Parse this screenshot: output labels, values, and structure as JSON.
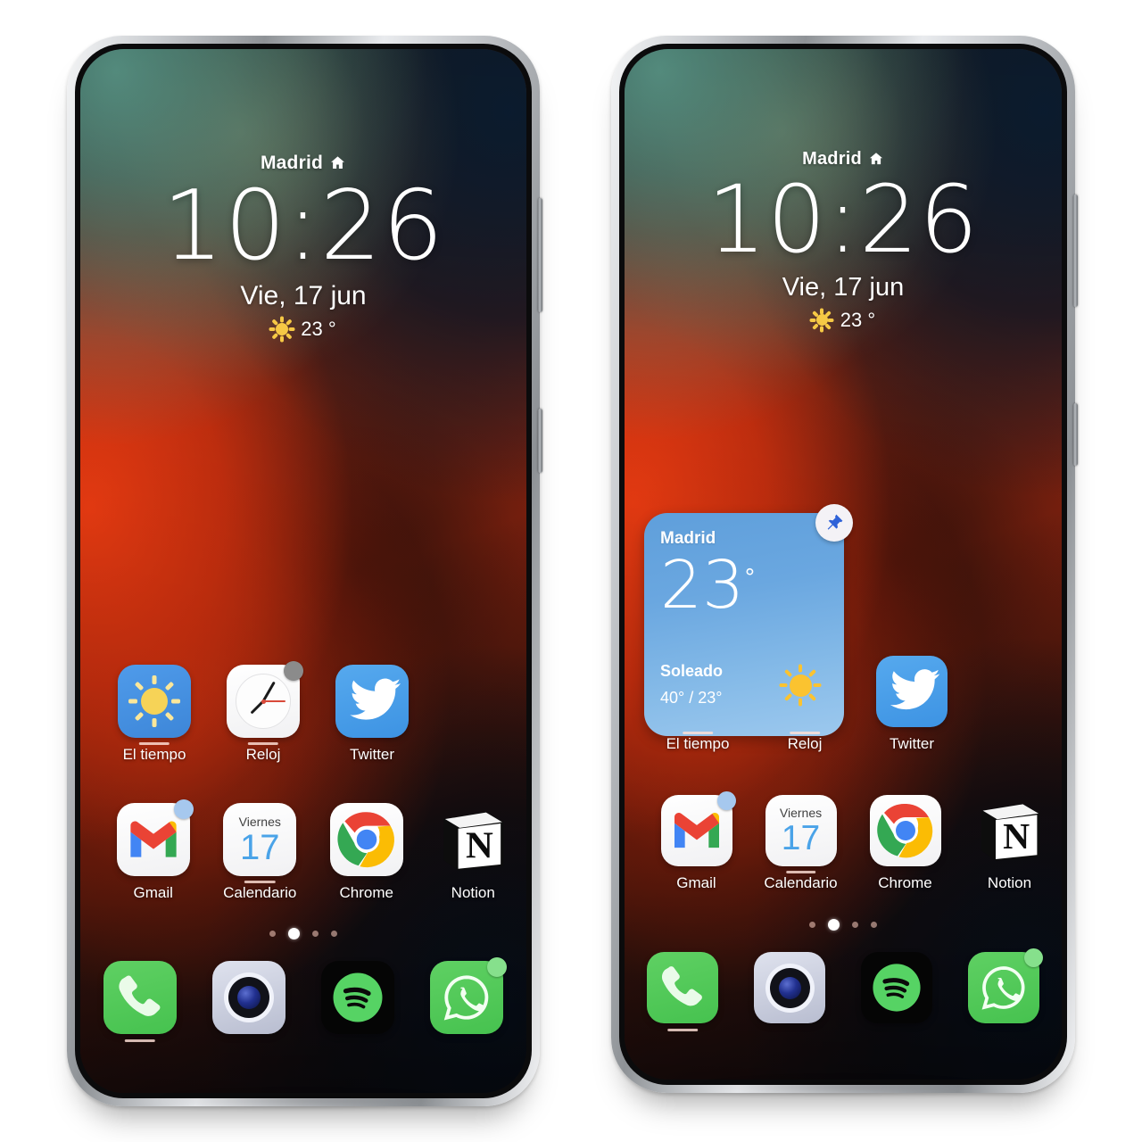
{
  "meta": {
    "scene": "two-android-phones-home-screen",
    "accent_blue": "#4a90e2",
    "wallpaper_colors": [
      "#2e5e58",
      "#b0aa78",
      "#0a1c30",
      "#ec3c12",
      "#090a10"
    ]
  },
  "phones": [
    {
      "id": "left",
      "lock": {
        "location": "Madrid",
        "home_icon": "home-icon",
        "time": "10:26",
        "date": "Vie, 17 jun",
        "weather_icon": "sun-icon",
        "temperature": "23 °"
      },
      "has_widget": false,
      "rows": [
        {
          "apps": [
            {
              "name": "El tiempo",
              "icon": "weather-icon",
              "badge": null,
              "open_bar": true
            },
            {
              "name": "Reloj",
              "icon": "clock-icon",
              "badge": "gray",
              "open_bar": true
            },
            {
              "name": "Twitter",
              "icon": "twitter-icon",
              "badge": null,
              "open_bar": false
            }
          ]
        },
        {
          "apps": [
            {
              "name": "Gmail",
              "icon": "gmail-icon",
              "badge": "blue",
              "open_bar": false
            },
            {
              "name": "Calendario",
              "icon": "calendar-icon",
              "badge": null,
              "open_bar": true
            },
            {
              "name": "Chrome",
              "icon": "chrome-icon",
              "badge": null,
              "open_bar": false
            },
            {
              "name": "Notion",
              "icon": "notion-icon",
              "badge": null,
              "open_bar": false
            }
          ]
        }
      ],
      "calendar": {
        "weekday": "Viernes",
        "day": "17"
      },
      "pager": {
        "count": 4,
        "active_index": 1
      },
      "dock": [
        {
          "name": "Telefono",
          "icon": "phone-icon",
          "badge": null,
          "open_bar": true
        },
        {
          "name": "Camara",
          "icon": "camera-icon",
          "badge": null,
          "open_bar": false
        },
        {
          "name": "Spotify",
          "icon": "spotify-icon",
          "badge": null,
          "open_bar": false
        },
        {
          "name": "WhatsApp",
          "icon": "whatsapp-icon",
          "badge": "green",
          "open_bar": false
        }
      ]
    },
    {
      "id": "right",
      "lock": {
        "location": "Madrid",
        "home_icon": "home-icon",
        "time": "10:26",
        "date": "Vie, 17 jun",
        "weather_icon": "sun-icon",
        "temperature": "23 °"
      },
      "has_widget": true,
      "widget": {
        "type": "weather-widget",
        "city": "Madrid",
        "temperature": "23",
        "degree_symbol": "°",
        "condition": "Soleado",
        "range": "40° / 23°",
        "condition_icon": "sun-icon",
        "pin_icon": "pin-icon"
      },
      "rows": [
        {
          "apps": [
            {
              "name": "El tiempo",
              "icon": "weather-icon",
              "badge": null,
              "open_bar": true
            },
            {
              "name": "Reloj",
              "icon": "clock-icon",
              "badge": "gray",
              "open_bar": true
            },
            {
              "name": "Twitter",
              "icon": "twitter-icon",
              "badge": null,
              "open_bar": false
            }
          ]
        },
        {
          "apps": [
            {
              "name": "Gmail",
              "icon": "gmail-icon",
              "badge": "blue",
              "open_bar": false
            },
            {
              "name": "Calendario",
              "icon": "calendar-icon",
              "badge": null,
              "open_bar": true
            },
            {
              "name": "Chrome",
              "icon": "chrome-icon",
              "badge": null,
              "open_bar": false
            },
            {
              "name": "Notion",
              "icon": "notion-icon",
              "badge": null,
              "open_bar": false
            }
          ]
        }
      ],
      "calendar": {
        "weekday": "Viernes",
        "day": "17"
      },
      "pager": {
        "count": 4,
        "active_index": 1
      },
      "dock": [
        {
          "name": "Telefono",
          "icon": "phone-icon",
          "badge": null,
          "open_bar": true
        },
        {
          "name": "Camara",
          "icon": "camera-icon",
          "badge": null,
          "open_bar": false
        },
        {
          "name": "Spotify",
          "icon": "spotify-icon",
          "badge": null,
          "open_bar": false
        },
        {
          "name": "WhatsApp",
          "icon": "whatsapp-icon",
          "badge": "green",
          "open_bar": false
        }
      ]
    }
  ]
}
